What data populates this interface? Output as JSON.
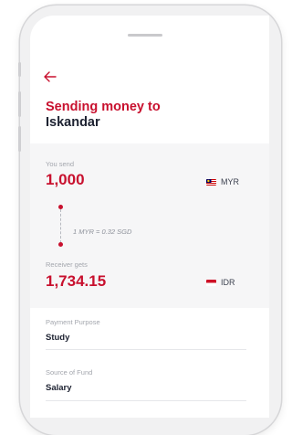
{
  "header": {
    "back_icon": "arrow-left-icon",
    "title_line1": "Sending money to",
    "title_line2": "Iskandar"
  },
  "send": {
    "label": "You send",
    "amount": "1,000",
    "currency": "MYR",
    "flag_icon": "malaysia-flag-icon"
  },
  "rate": {
    "text": "1 MYR = 0.32 SGD"
  },
  "receive": {
    "label": "Receiver gets",
    "amount": "1,734.15",
    "currency": "IDR",
    "flag_icon": "indonesia-flag-icon"
  },
  "form": {
    "payment_purpose_label": "Payment Purpose",
    "payment_purpose_value": "Study",
    "source_of_fund_label": "Source of Fund",
    "source_of_fund_value": "Salary"
  },
  "colors": {
    "accent": "#c8102e",
    "text_dark": "#1d2231",
    "muted": "#a3a6ad"
  }
}
